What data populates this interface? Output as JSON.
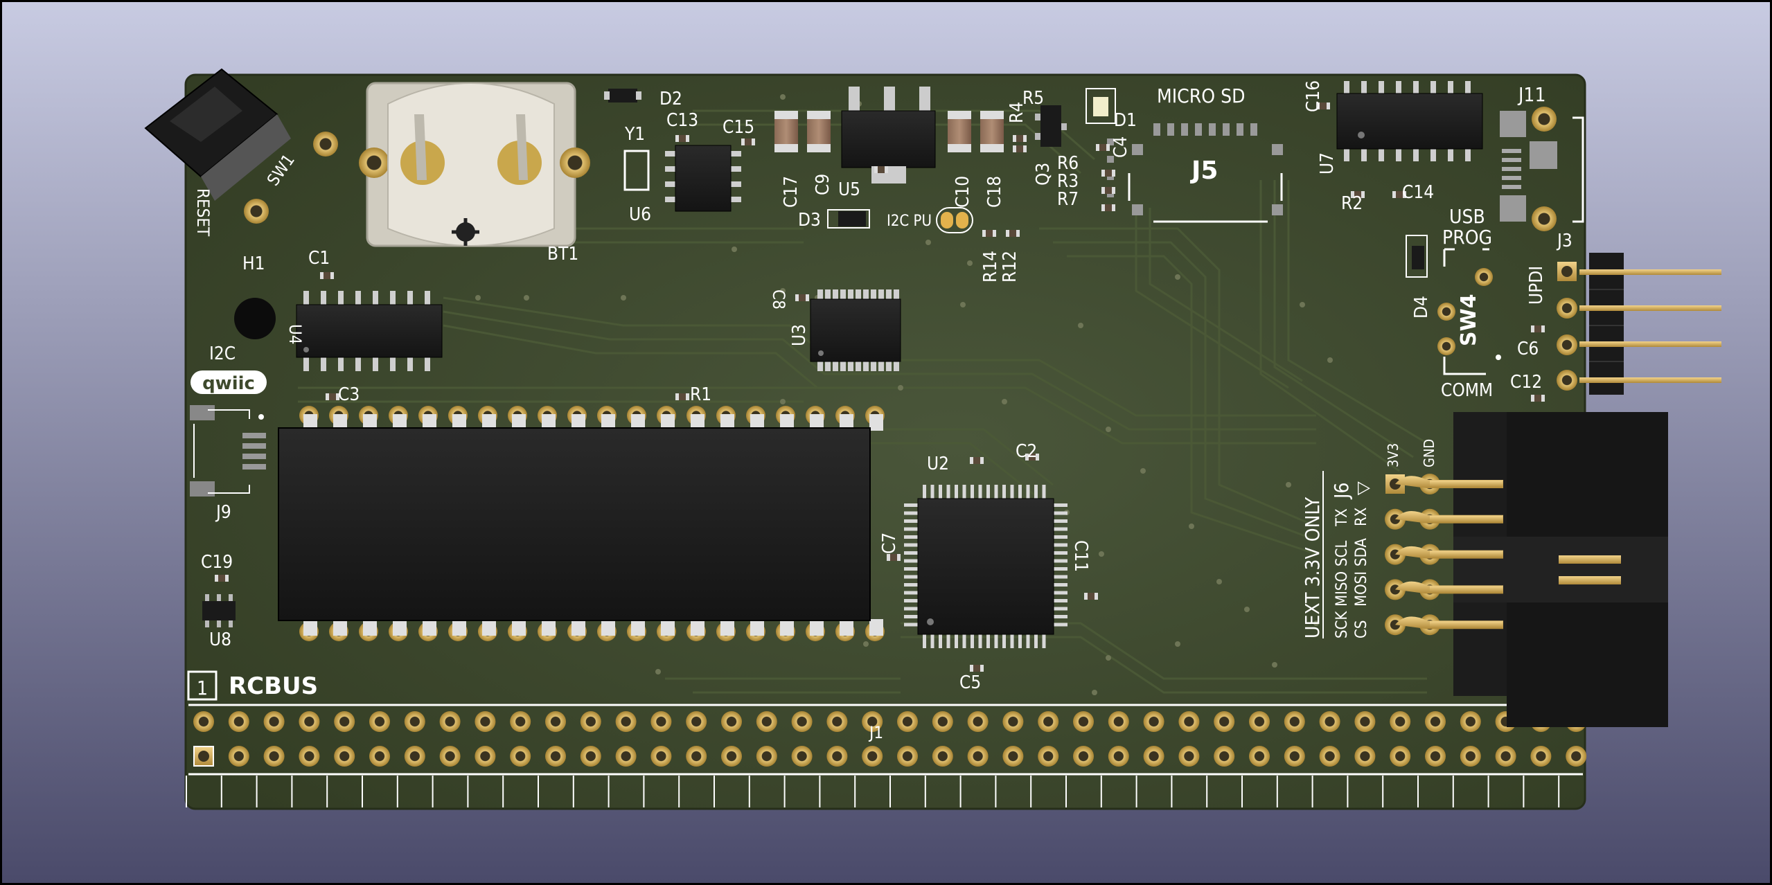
{
  "viewer": {
    "background_top": "#c8cbe2",
    "background_bottom": "#4a4a6a"
  },
  "board": {
    "solder_mask_color": "#3e4a2c",
    "silkscreen_color": "#ffffff",
    "brand": "RCBUS",
    "pin1_label": "1",
    "labels": {
      "reset": "RESET",
      "sw1": "SW1",
      "h1": "H1",
      "bt1": "BT1",
      "i2c": "I2C",
      "qwiic": "qwiic",
      "j9": "J9",
      "c19": "C19",
      "u8": "U8",
      "c1": "C1",
      "u4": "U4",
      "c3": "C3",
      "r1": "R1",
      "d2": "D2",
      "y1": "Y1",
      "c13": "C13",
      "c15": "C15",
      "u6": "U6",
      "c17": "C17",
      "c9": "C9",
      "u5": "U5",
      "d3": "D3",
      "i2c_pu": "I2C PU",
      "c10": "C10",
      "c18": "C18",
      "r5": "R5",
      "r4": "R4",
      "q3": "Q3",
      "d1": "D1",
      "c4": "C4",
      "r6": "R6",
      "r3": "R3",
      "r7": "R7",
      "r14": "R14",
      "r12": "R12",
      "micro_sd": "MICRO SD",
      "j5": "J5",
      "c16": "C16",
      "u7": "U7",
      "r2": "R2",
      "c14": "C14",
      "j11": "J11",
      "usb": "USB",
      "prog": "PROG",
      "j3": "J3",
      "updi": "UPDI",
      "d4": "D4",
      "sw4": "SW4",
      "c6": "C6",
      "c12": "C12",
      "comm": "COMM",
      "c8": "C8",
      "u3": "U3",
      "u2": "U2",
      "c2": "C2",
      "c7": "C7",
      "c11": "C11",
      "c5": "C5",
      "j1": "J1",
      "uext": "UEXT 3.3V ONLY",
      "j6": "J6",
      "pin_3v3": "3V3",
      "pin_gnd": "GND",
      "pin_tx": "TX",
      "pin_rx": "RX",
      "pin_scl": "SCL",
      "pin_sda": "SDA",
      "pin_miso": "MISO",
      "pin_mosi": "MOSI",
      "pin_sck": "SCK",
      "pin_cs": "CS"
    }
  }
}
